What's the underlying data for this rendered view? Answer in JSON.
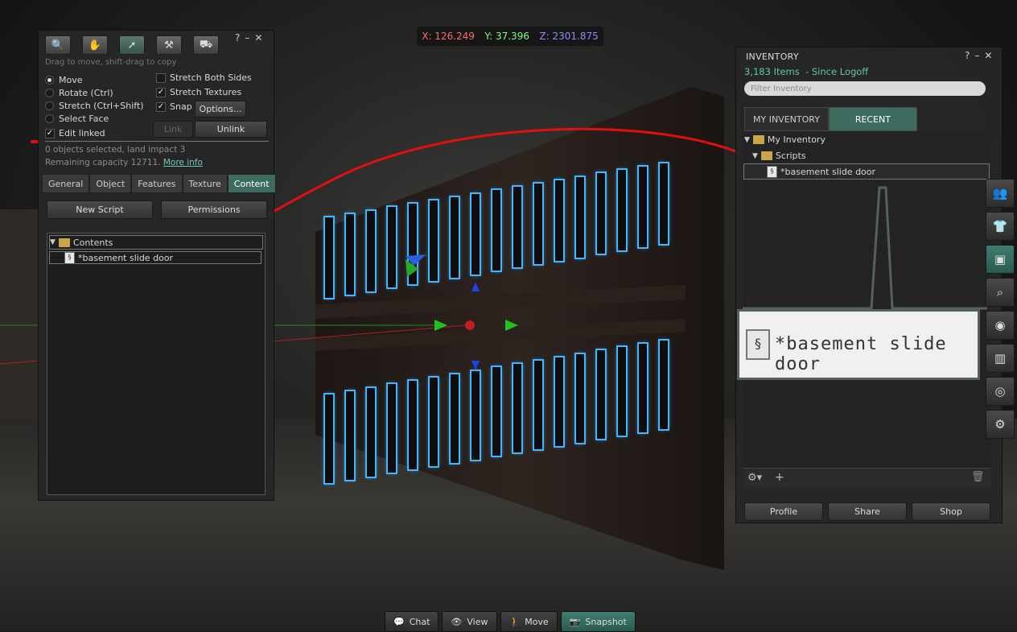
{
  "coords": {
    "x": "X: 126.249",
    "y": "Y: 37.396",
    "z": "Z: 2301.875"
  },
  "tools": {
    "hint": "Drag to move, shift-drag to copy",
    "modes": [
      "Move",
      "Rotate (Ctrl)",
      "Stretch (Ctrl+Shift)",
      "Select Face"
    ],
    "edit_linked": "Edit linked",
    "stretch_both": "Stretch Both Sides",
    "stretch_textures": "Stretch Textures",
    "snap": "Snap",
    "options": "Options...",
    "link": "Link",
    "unlink": "Unlink",
    "status": "0 objects selected, land impact 3",
    "capacity": "Remaining capacity 12711.",
    "more_info": "More info",
    "tabs": [
      "General",
      "Object",
      "Features",
      "Texture",
      "Content"
    ],
    "new_script": "New Script",
    "permissions": "Permissions",
    "contents_folder": "Contents",
    "contents_item": "*basement slide door"
  },
  "inventory": {
    "title": "INVENTORY",
    "count": "3,183 Items",
    "since": "- Since Logoff",
    "filter_placeholder": "Filter Inventory",
    "tab_my": "MY INVENTORY",
    "tab_recent": "RECENT",
    "root": "My Inventory",
    "folder": "Scripts",
    "item": "*basement slide door",
    "profile": "Profile",
    "share": "Share",
    "shop": "Shop",
    "zoom_label": "*basement slide door"
  },
  "bottom_bar": {
    "chat": "Chat",
    "view": "View",
    "move": "Move",
    "snapshot": "Snapshot"
  },
  "colors": {
    "accent": "#3d6b60",
    "glow": "#3fb6ff",
    "annotation": "#e01010"
  }
}
